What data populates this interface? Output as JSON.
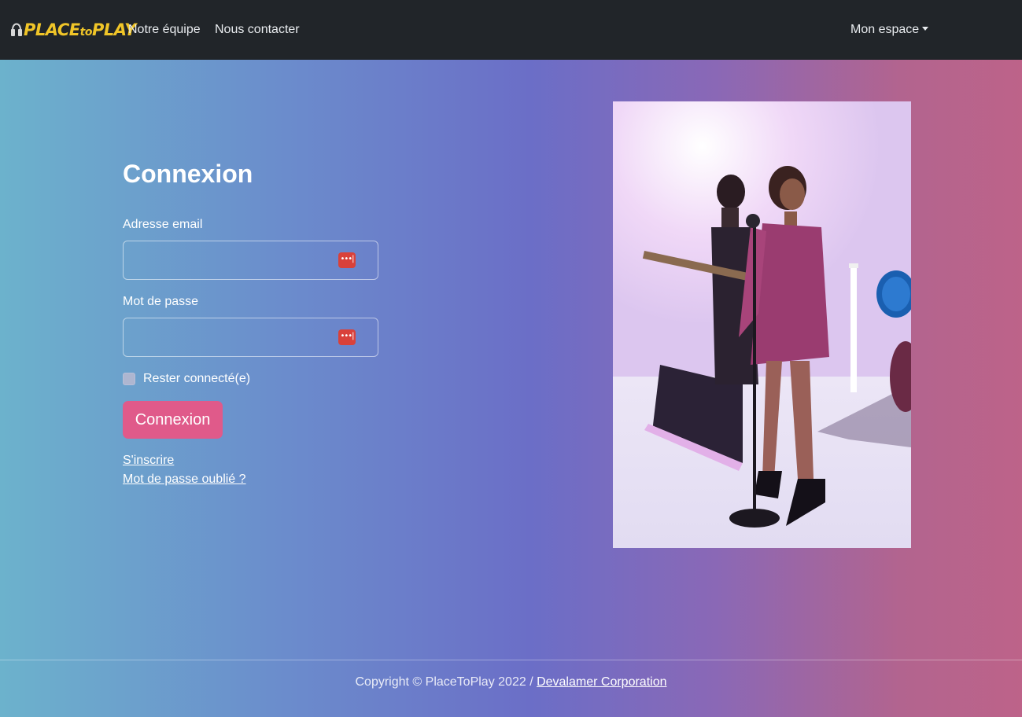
{
  "navbar": {
    "logo_text_place": "PLACE",
    "logo_text_to": "to",
    "logo_text_play": "PLAY",
    "links": [
      "Notre équipe",
      "Nous contacter"
    ],
    "account_menu": "Mon espace"
  },
  "login": {
    "title": "Connexion",
    "email_label": "Adresse email",
    "email_value": "",
    "password_label": "Mot de passe",
    "password_value": "",
    "remember_label": "Rester connecté(e)",
    "remember_checked": false,
    "submit_label": "Connexion",
    "signup_link": "S'inscrire",
    "forgot_link": "Mot de passe oublié ?",
    "password_manager_icon": "•••|"
  },
  "footer": {
    "copyright": "Copyright © PlaceToPlay 2022 / ",
    "company_link": "Devalamer Corporation"
  },
  "colors": {
    "navbar": "#212529",
    "logo": "#f0c528",
    "button": "#e05a8a",
    "password_manager": "#d9413a"
  },
  "icons": {
    "logo": "headphones-icon",
    "dropdown": "caret-down-icon",
    "password_manager": "password-manager-icon"
  }
}
